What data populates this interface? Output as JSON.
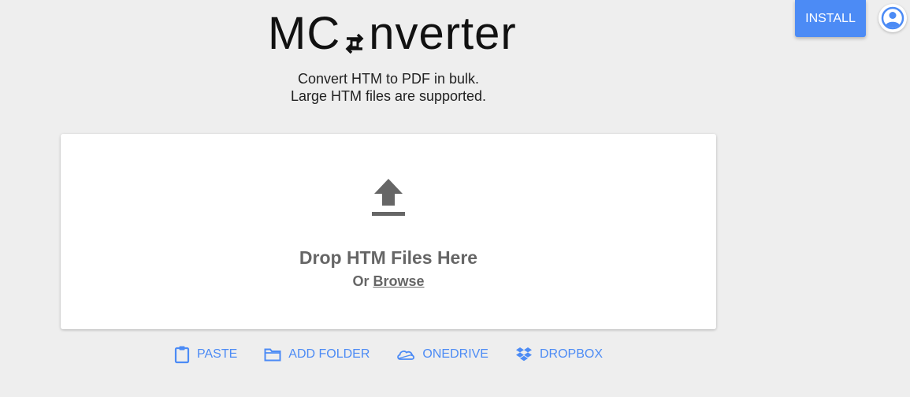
{
  "header": {
    "logo_prefix": "MC",
    "logo_suffix": "nverter",
    "tagline_line1": "Convert HTM to PDF in bulk.",
    "tagline_line2": "Large HTM files are supported."
  },
  "topbar": {
    "install_label": "INSTALL",
    "account_icon": "account-circle-icon"
  },
  "dropzone": {
    "icon": "upload-icon",
    "title": "Drop HTM Files Here",
    "or_text": "Or",
    "browse_label": "Browse"
  },
  "sources": [
    {
      "label": "PASTE",
      "icon": "clipboard-icon"
    },
    {
      "label": "ADD FOLDER",
      "icon": "folder-icon"
    },
    {
      "label": "ONEDRIVE",
      "icon": "onedrive-icon"
    },
    {
      "label": "DROPBOX",
      "icon": "dropbox-icon"
    }
  ],
  "colors": {
    "accent": "#4c8bf5",
    "background": "#eeeeee",
    "dropzone_text": "#666666"
  }
}
